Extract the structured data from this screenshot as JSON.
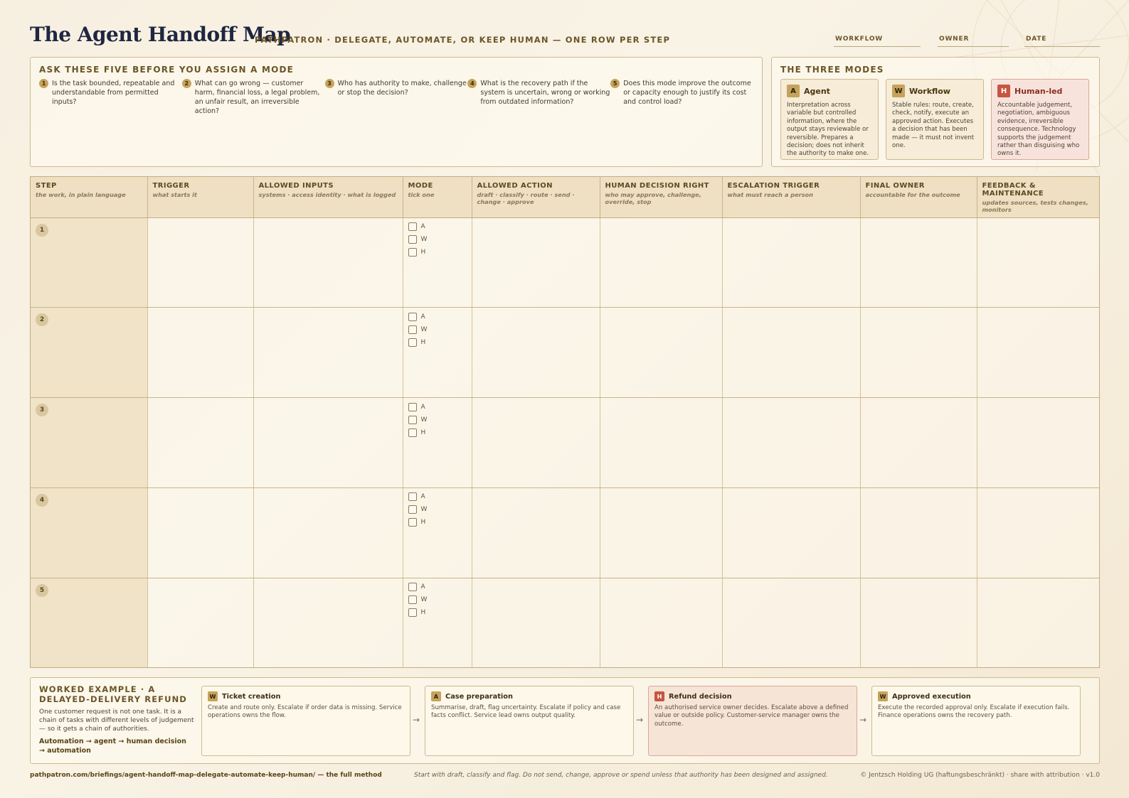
{
  "header": {
    "title": "The Agent Handoff Map",
    "subtitle": "PATHPATRON · DELEGATE, AUTOMATE, OR KEEP HUMAN — ONE ROW PER STEP",
    "fields": [
      "WORKFLOW",
      "OWNER",
      "DATE"
    ]
  },
  "questions": {
    "title": "ASK THESE FIVE BEFORE YOU ASSIGN A MODE",
    "items": [
      {
        "num": "1",
        "text": "Is the task bounded, repeatable and understandable from permitted inputs?"
      },
      {
        "num": "2",
        "text": "What can go wrong — customer harm, financial loss, a legal problem, an unfair result, an irreversible action?"
      },
      {
        "num": "3",
        "text": "Who has authority to make, challenge or stop the decision?"
      },
      {
        "num": "4",
        "text": "What is the recovery path if the system is uncertain, wrong or working from outdated information?"
      },
      {
        "num": "5",
        "text": "Does this mode improve the outcome or capacity enough to justify its cost and control load?"
      }
    ]
  },
  "modes": {
    "title": "THE THREE MODES",
    "items": [
      {
        "badge": "A",
        "name": "Agent",
        "desc": "Interpretation across variable but controlled information, where the output stays reviewable or reversible. Prepares a decision; does not inherit the authority to make one."
      },
      {
        "badge": "W",
        "name": "Workflow",
        "desc": "Stable rules: route, create, check, notify, execute an approved action. Executes a decision that has been made — it must not invent one."
      },
      {
        "badge": "H",
        "name": "Human-led",
        "desc": "Accountable judgement, negotiation, ambiguous evidence, irreversible consequence. Technology supports the judgement rather than disguising who owns it."
      }
    ]
  },
  "table": {
    "columns": [
      {
        "head": "STEP",
        "sub": "the work, in plain language"
      },
      {
        "head": "TRIGGER",
        "sub": "what starts it"
      },
      {
        "head": "ALLOWED INPUTS",
        "sub": "systems · access identity · what is logged"
      },
      {
        "head": "MODE",
        "sub": "tick one"
      },
      {
        "head": "ALLOWED ACTION",
        "sub": "draft · classify · route · send · change · approve"
      },
      {
        "head": "HUMAN DECISION RIGHT",
        "sub": "who may approve, challenge, override, stop"
      },
      {
        "head": "ESCALATION TRIGGER",
        "sub": "what must reach a person"
      },
      {
        "head": "FINAL OWNER",
        "sub": "accountable for the outcome"
      },
      {
        "head": "FEEDBACK & MAINTENANCE",
        "sub": "updates sources, tests changes, monitors"
      }
    ],
    "rows": [
      "1",
      "2",
      "3",
      "4",
      "5"
    ],
    "mode_options": [
      "A",
      "W",
      "H"
    ]
  },
  "example": {
    "title": "WORKED EXAMPLE · A DELAYED-DELIVERY REFUND",
    "text": "One customer request is not one task. It is a chain of tasks with different levels of judgement — so it gets a chain of authorities.",
    "chain": "Automation → agent → human decision → automation",
    "arrow": "→",
    "cards": [
      {
        "badge": "W",
        "name": "Ticket creation",
        "desc": "Create and route only. Escalate if order data is missing. Service operations owns the flow."
      },
      {
        "badge": "A",
        "name": "Case preparation",
        "desc": "Summarise, draft, flag uncertainty. Escalate if policy and case facts conflict. Service lead owns output quality."
      },
      {
        "badge": "H",
        "name": "Refund decision",
        "desc": "An authorised service owner decides. Escalate above a defined value or outside policy. Customer-service manager owns the outcome."
      },
      {
        "badge": "W",
        "name": "Approved execution",
        "desc": "Execute the recorded approval only. Escalate if execution fails. Finance operations owns the recovery path."
      }
    ]
  },
  "footer": {
    "left": "pathpatron.com/briefings/agent-handoff-map-delegate-automate-keep-human/ — the full method",
    "middle": "Start with draft, classify and flag. Do not send, change, approve or spend unless that authority has been designed and assigned.",
    "right": "© Jentzsch Holding UG (haftungsbeschränkt) · share with attribution · v1.0"
  }
}
